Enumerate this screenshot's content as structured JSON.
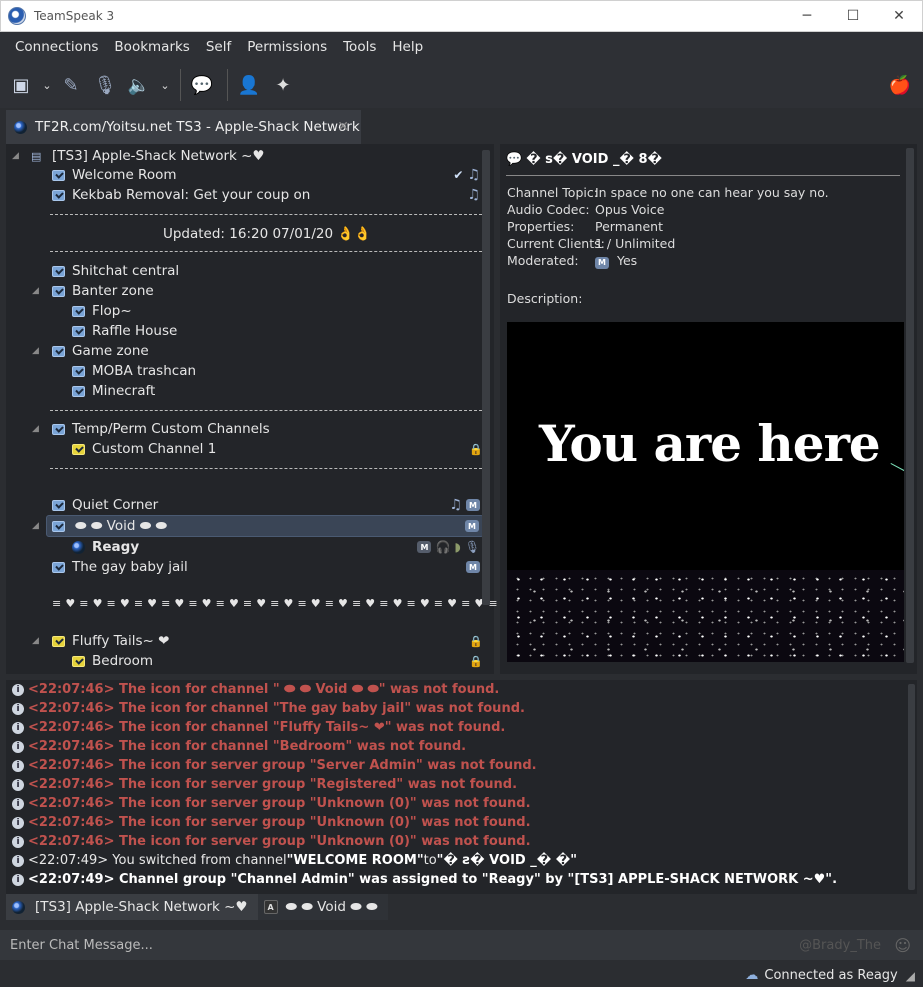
{
  "window": {
    "title": "TeamSpeak 3"
  },
  "menu": [
    "Connections",
    "Bookmarks",
    "Self",
    "Permissions",
    "Tools",
    "Help"
  ],
  "server_tab": {
    "label": "TF2R.com/Yoitsu.net TS3 - Apple-Shack Network"
  },
  "tree": {
    "server_name": "[TS3] Apple-Shack Network ~♥",
    "welcome": "Welcome Room",
    "kekbab": "Kekbab Removal: Get your coup on",
    "updated": "Updated: 16:20 07/01/20 👌👌",
    "shitchat": "Shitchat central",
    "banter": "Banter zone",
    "flop": "Flop~",
    "raffle": "Raffle House",
    "game": "Game zone",
    "moba": "MOBA trashcan",
    "minecraft": "Minecraft",
    "temp": "Temp/Perm Custom Channels",
    "custom1": "Custom Channel 1",
    "quiet": "Quiet Corner",
    "void": "⬬ ⬬ Void ⬬ ⬬",
    "reagy": "Reagy",
    "gaybaby": "The gay baby jail",
    "hearts": "≡ ♥ ≡ ♥ ≡ ♥ ≡ ♥ ≡ ♥ ≡ ♥ ≡ ♥ ≡ ♥ ≡ ♥ ≡ ♥ ≡ ♥ ≡ ♥ ≡ ♥ ≡ ♥ ≡ ♥ ≡ ♥ ≡ ♥ ≡ ♥ ≡ ♥",
    "fluffy": "Fluffy Tails~ ❤",
    "bedroom": "Bedroom"
  },
  "info": {
    "header": "� s� VOID _� 8�",
    "topic_label": "Channel Topic:",
    "topic_value": "In space no one can hear you say no.",
    "codec_label": "Audio Codec:",
    "codec_value": "Opus Voice",
    "props_label": "Properties:",
    "props_value": "Permanent",
    "clients_label": "Current Clients:",
    "clients_value": "1 / Unlimited",
    "moderated_label": "Moderated:",
    "moderated_value": "Yes",
    "desc_label": "Description:",
    "banner_text": "You are here"
  },
  "log": {
    "l1": "<22:07:46> The icon for channel \" ⬬ ⬬ Void  ⬬ ⬬\" was not found.",
    "l2": "<22:07:46> The icon for channel \"The gay baby jail\" was not found.",
    "l3": "<22:07:46> The icon for channel \"Fluffy Tails~ ❤\" was not found.",
    "l4": "<22:07:46> The icon for channel \"Bedroom\" was not found.",
    "l5": "<22:07:46> The icon for server group \"Server Admin\" was not found.",
    "l6": "<22:07:46> The icon for server group \"Registered\" was not found.",
    "l7": "<22:07:46> The icon for server group \"Unknown (0)\" was not found.",
    "l8": "<22:07:46> The icon for server group \"Unknown (0)\" was not found.",
    "l9": "<22:07:46> The icon for server group \"Unknown (0)\" was not found.",
    "l10_a": "<22:07:49> You switched from channel ",
    "l10_b": "\"WELCOME ROOM\"",
    "l10_c": " to ",
    "l10_d": "\"� ƨ� VOID _� �\"",
    "l11": "<22:07:49> Channel group \"Channel Admin\" was assigned to \"Reagy\" by \"[TS3] APPLE-SHACK NETWORK ~♥\"."
  },
  "chat_tabs": {
    "server": "[TS3] Apple-Shack Network ~♥",
    "channel": "⬬ ⬬ Void ⬬ ⬬",
    "channel_badge": "A"
  },
  "chat": {
    "placeholder": "Enter Chat Message...",
    "user_hint": "@Brady_The"
  },
  "status": {
    "connected": "Connected as Reagy"
  }
}
